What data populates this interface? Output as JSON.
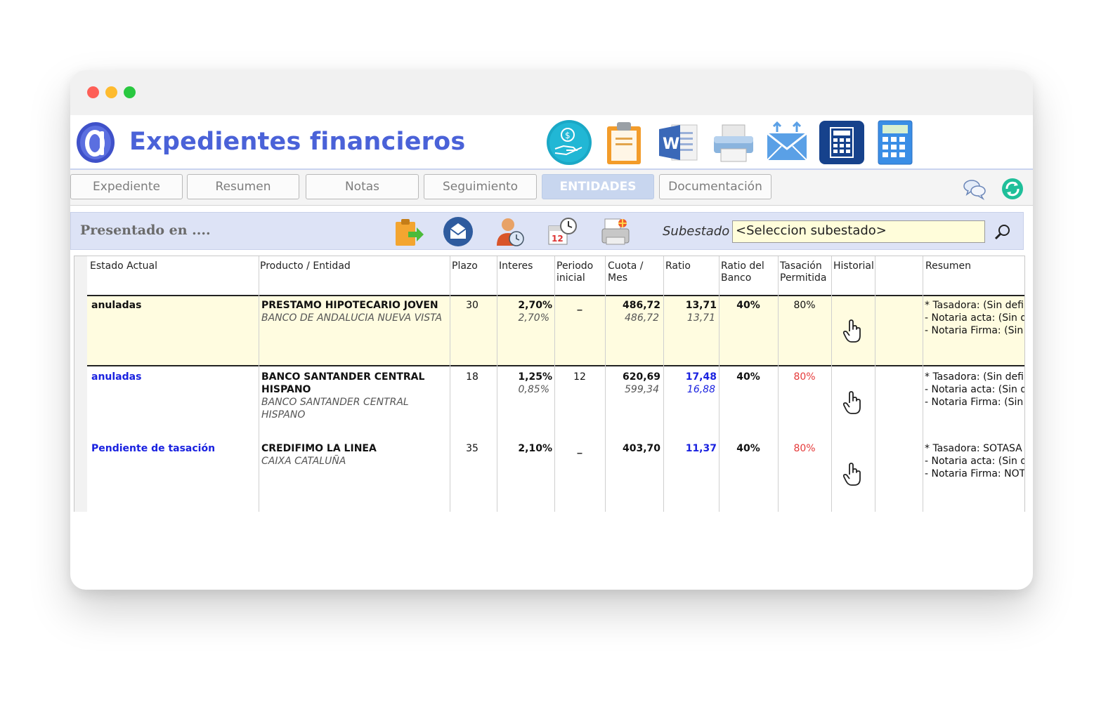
{
  "app": {
    "title": "Expedientes financieros"
  },
  "tabs": [
    {
      "label": "Expediente"
    },
    {
      "label": "Resumen"
    },
    {
      "label": "Notas"
    },
    {
      "label": "Seguimiento"
    },
    {
      "label": "ENTIDADES",
      "active": true
    },
    {
      "label": "Documentación"
    }
  ],
  "toolbar_icons": [
    "money-hand-icon",
    "clipboard-icon",
    "word-document-icon",
    "printer-icon",
    "email-icon",
    "calculator-dark-icon",
    "calculator-blue-icon"
  ],
  "panel": {
    "title": "Presentado en ....",
    "subestado_label": "Subestado",
    "subestado_value": "<Seleccion subestado>"
  },
  "columns": [
    "Estado Actual",
    "Producto / Entidad",
    "Plazo",
    "Interes",
    "Periodo inicial",
    "Cuota / Mes",
    "Ratio",
    "Ratio del Banco",
    "Tasación Permitida",
    "Historial",
    "",
    "Resumen"
  ],
  "column_headers": {
    "estado": "Estado Actual",
    "producto": "Producto / Entidad",
    "plazo": "Plazo",
    "interes": "Interes",
    "periodo_1": "Periodo",
    "periodo_2": "inicial",
    "cuota_1": "Cuota /",
    "cuota_2": "Mes",
    "ratio": "Ratio",
    "ratio_banco_1": "Ratio del",
    "ratio_banco_2": "Banco",
    "tasacion_1": "Tasación",
    "tasacion_2": "Permitida",
    "historial": "Historial",
    "resumen": "Resumen"
  },
  "rows": [
    {
      "estado": "anuladas",
      "producto": "PRESTAMO HIPOTECARIO JOVEN",
      "entidad": "BANCO DE ANDALUCIA NUEVA VISTA",
      "plazo": "30",
      "interes": "2,70%",
      "interes_sub": "2,70%",
      "periodo": "_",
      "cuota": "486,72",
      "cuota_sub": "486,72",
      "ratio": "13,71",
      "ratio_sub": "13,71",
      "ratio_banco": "40%",
      "tasacion": "80%",
      "resumen": "* Tasadora: (Sin defi\n- Notaria acta: (Sin d\n- Notaria Firma: (Sin d"
    },
    {
      "estado": "anuladas",
      "producto": "BANCO SANTANDER CENTRAL HISPANO",
      "producto_1": "BANCO SANTANDER CENTRAL",
      "producto_2": "HISPANO",
      "entidad_1": "BANCO SANTANDER CENTRAL",
      "entidad_2": "HISPANO",
      "plazo": "18",
      "interes": "1,25%",
      "interes_sub": "0,85%",
      "periodo": "12",
      "cuota": "620,69",
      "cuota_sub": "599,34",
      "ratio": "17,48",
      "ratio_sub": "16,88",
      "ratio_banco": "40%",
      "tasacion": "80%",
      "resumen": "* Tasadora: (Sin defi\n- Notaria acta: (Sin d\n- Notaria Firma: (Sin d"
    },
    {
      "estado": "Pendiente de tasación",
      "producto": "CREDIFIMO LA LINEA",
      "entidad": "CAIXA CATALUÑA",
      "plazo": "35",
      "interes": "2,10%",
      "periodo": "_",
      "cuota": "403,70",
      "ratio": "11,37",
      "ratio_banco": "40%",
      "tasacion": "80%",
      "resumen": "* Tasadora: SOTASA\n- Notaria acta: (Sin d\n- Notaria Firma: NOTA"
    }
  ],
  "colors": {
    "title_blue": "#4a62d8",
    "status_blue": "#1a22e0",
    "tasacion_red": "#e53a3a",
    "highlight_row": "#fffce0",
    "panel_bg": "#dde3f6"
  }
}
